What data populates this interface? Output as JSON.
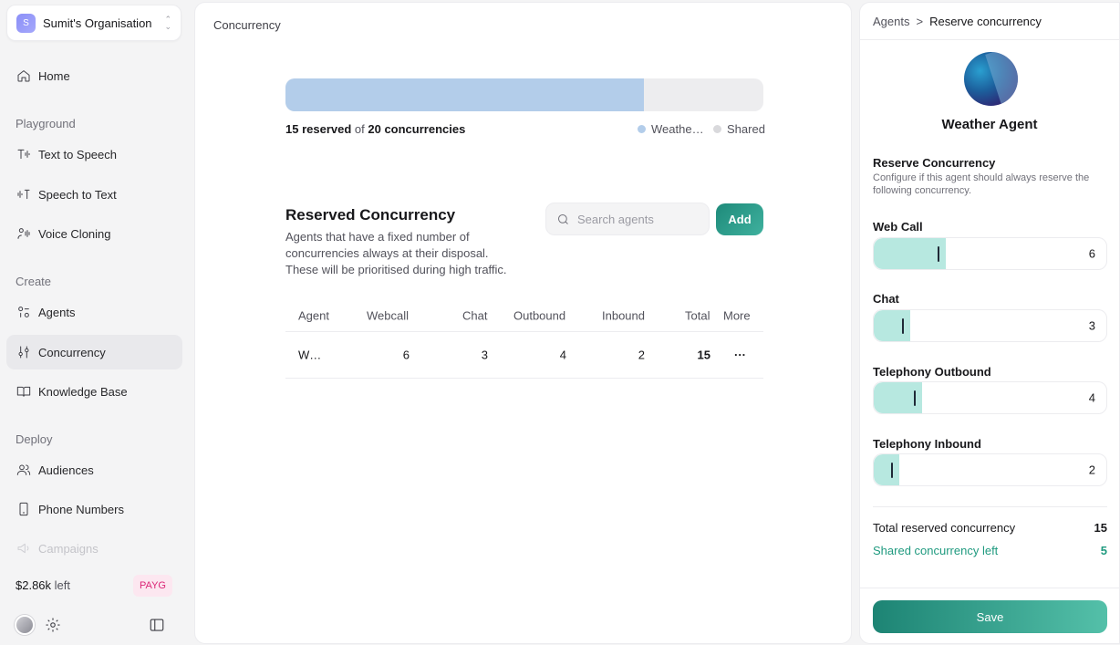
{
  "sidebar": {
    "org": {
      "initial": "S",
      "name": "Sumit's Organisation"
    },
    "home": "Home",
    "sections": {
      "playground": "Playground",
      "create": "Create",
      "deploy": "Deploy"
    },
    "items": {
      "tts": "Text to Speech",
      "stt": "Speech to Text",
      "voice_cloning": "Voice Cloning",
      "agents": "Agents",
      "concurrency": "Concurrency",
      "knowledge_base": "Knowledge Base",
      "audiences": "Audiences",
      "phone_numbers": "Phone Numbers",
      "campaigns": "Campaigns"
    },
    "active": "concurrency",
    "credits_amount": "$2.86k",
    "credits_suffix": "left",
    "plan_badge": "PAYG"
  },
  "main": {
    "breadcrumb": "Concurrency",
    "usage": {
      "reserved": 15,
      "total": 20,
      "reserved_label": "15 reserved",
      "of_label": "of",
      "total_label": "20 concurrencies",
      "legend": [
        {
          "label": "Weathe…",
          "color": "#b3cdea"
        },
        {
          "label": "Shared",
          "color": "#d9d9dc"
        }
      ]
    },
    "reserved_section": {
      "title": "Reserved Concurrency",
      "description": "Agents that have a fixed number of concurrencies always at their disposal. These will be prioritised during high traffic.",
      "search_placeholder": "Search agents",
      "add_label": "Add"
    },
    "table": {
      "headers": {
        "agent": "Agent",
        "webcall": "Webcall",
        "chat": "Chat",
        "outbound": "Outbound",
        "inbound": "Inbound",
        "total": "Total",
        "more": "More"
      },
      "rows": [
        {
          "agent": "W…",
          "webcall": "6",
          "chat": "3",
          "outbound": "4",
          "inbound": "2",
          "total": "15",
          "more": "···"
        }
      ]
    }
  },
  "panel": {
    "breadcrumb": {
      "parent": "Agents",
      "sep": ">",
      "current": "Reserve concurrency"
    },
    "agent_name": "Weather Agent",
    "title": "Reserve Concurrency",
    "subtitle": "Configure if this agent should always reserve the following concurrency.",
    "slider_max": 20,
    "sliders": {
      "web_call": {
        "label": "Web Call",
        "value": 6
      },
      "chat": {
        "label": "Chat",
        "value": 3
      },
      "outbound": {
        "label": "Telephony Outbound",
        "value": 4
      },
      "inbound": {
        "label": "Telephony Inbound",
        "value": 2
      }
    },
    "summary": {
      "total_label": "Total reserved concurrency",
      "total_value": "15",
      "shared_label": "Shared concurrency left",
      "shared_value": "5"
    },
    "save_label": "Save",
    "accent": "#1f9a7f"
  }
}
